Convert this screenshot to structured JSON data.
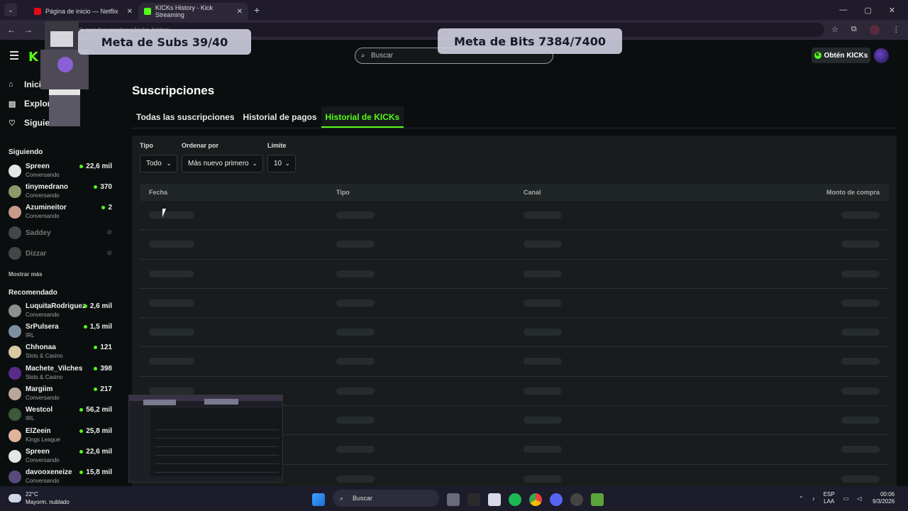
{
  "browser": {
    "tabs": [
      {
        "title": "Página de inicio — Netflix",
        "favicon_color": "#e50914"
      },
      {
        "title": "KICKs History - Kick Streaming",
        "favicon_color": "#53fc18"
      }
    ],
    "new_tab": "+",
    "window_controls": [
      "—",
      "▢",
      "✕"
    ],
    "address": "kick.com/transactions/kicks-history"
  },
  "overlays": {
    "subs": "Meta de Subs  39/40",
    "bits": "Meta de Bits  7384/7400"
  },
  "header": {
    "logo": "K",
    "search_placeholder": "Buscar",
    "kicks_button": "Obtén KICKs",
    "accent": "#53fc18"
  },
  "sidebar": {
    "nav": [
      {
        "label": "Inicio",
        "icon": "home-icon"
      },
      {
        "label": "Explorar",
        "icon": "compass-icon"
      },
      {
        "label": "Siguiendo",
        "icon": "heart-icon"
      }
    ],
    "following_title": "Siguiendo",
    "following": [
      {
        "name": "Spreen",
        "category": "Conversando",
        "viewers": "22,6 mil",
        "color": "#e6e6e6"
      },
      {
        "name": "tinymedrano",
        "category": "Conversando",
        "viewers": "370",
        "color": "#8a9a6a"
      },
      {
        "name": "Azumineitor",
        "category": "Conversando",
        "viewers": "2",
        "color": "#c99a88"
      },
      {
        "name": "Saddey",
        "category": "",
        "viewers": "",
        "color": "#9a9a9a"
      },
      {
        "name": "Dizzar",
        "category": "",
        "viewers": "",
        "color": "#9a9a9a"
      }
    ],
    "show_more": "Mostrar más",
    "recommended_title": "Recomendado",
    "recommended": [
      {
        "name": "LuquitaRodriguez",
        "category": "Conversando",
        "viewers": "2,6 mil",
        "color": "#8f8f8f"
      },
      {
        "name": "SrPulsera",
        "category": "IRL",
        "viewers": "1,5 mil",
        "color": "#7d8fa3"
      },
      {
        "name": "Chhonaa",
        "category": "Slots & Casino",
        "viewers": "121",
        "color": "#d9c9a0"
      },
      {
        "name": "Machete_Vilches",
        "category": "Slots & Casino",
        "viewers": "398",
        "color": "#5a2b8a"
      },
      {
        "name": "Margiim",
        "category": "Conversando",
        "viewers": "217",
        "color": "#b9a79a"
      },
      {
        "name": "Westcol",
        "category": "IRL",
        "viewers": "56,2 mil",
        "color": "#3a5a3a"
      },
      {
        "name": "ElZeein",
        "category": "Kings League",
        "viewers": "25,8 mil",
        "color": "#e0b49a"
      },
      {
        "name": "Spreen",
        "category": "Conversando",
        "viewers": "22,6 mil",
        "color": "#e6e6e6"
      },
      {
        "name": "davooxeneize",
        "category": "Conversando",
        "viewers": "15,8 mil",
        "color": "#5a4a7a"
      }
    ]
  },
  "main": {
    "title": "Suscripciones",
    "tabs": [
      {
        "label": "Todas las suscripciones",
        "active": false
      },
      {
        "label": "Historial de pagos",
        "active": false
      },
      {
        "label": "Historial de KICKs",
        "active": true
      }
    ],
    "filters": {
      "type_label": "Tipo",
      "type_value": "Todo",
      "sort_label": "Ordenar por",
      "sort_value": "Más nuevo primero",
      "limit_label": "Límite",
      "limit_value": "10"
    },
    "table": {
      "columns": [
        "Fecha",
        "Tipo",
        "Canal",
        "Monto de compra"
      ],
      "loading_rows": 10
    }
  },
  "taskbar": {
    "weather_temp": "22°C",
    "weather_desc": "Mayorm. nublado",
    "search": "Buscar",
    "lang1": "ESP",
    "lang2": "LAA",
    "time": "00:06",
    "date": "9/3/2026"
  }
}
